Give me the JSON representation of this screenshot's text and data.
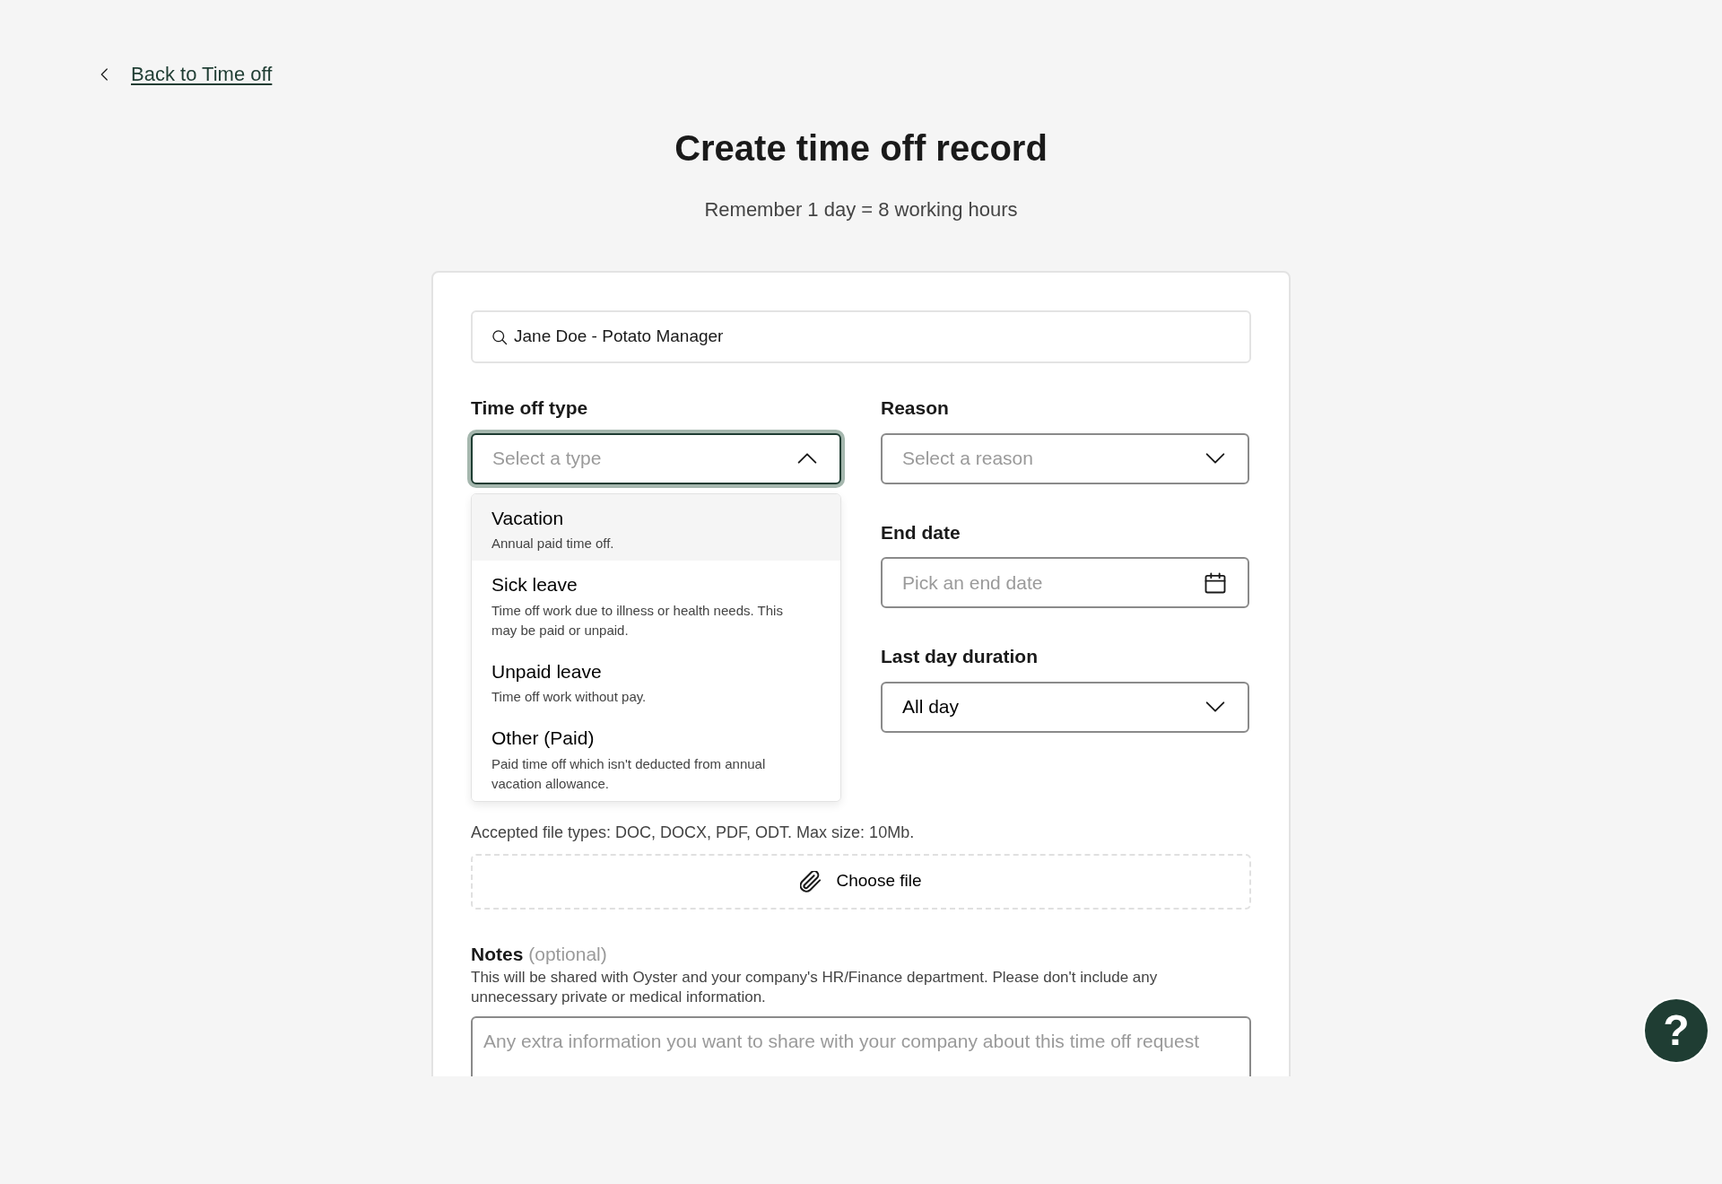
{
  "back_link": {
    "label": "Back to Time off"
  },
  "title": "Create time off record",
  "subtitle": "Remember 1 day = 8 working hours",
  "employee_search": {
    "value": "Jane Doe - Potato Manager"
  },
  "time_off_type": {
    "label": "Time off type",
    "placeholder": "Select a type",
    "expanded": true,
    "options": [
      {
        "label": "Vacation",
        "description": "Annual paid time off.",
        "highlighted": true
      },
      {
        "label": "Sick leave",
        "description": "Time off work due to illness or health needs. This may be paid or unpaid.",
        "highlighted": false
      },
      {
        "label": "Unpaid leave",
        "description": "Time off work without pay.",
        "highlighted": false
      },
      {
        "label": "Other (Paid)",
        "description": "Paid time off which isn't deducted from annual vacation allowance.",
        "highlighted": false
      }
    ]
  },
  "reason": {
    "label": "Reason",
    "placeholder": "Select a reason",
    "expanded": false
  },
  "end_date": {
    "label": "End date",
    "placeholder": "Pick an end date"
  },
  "last_day_duration": {
    "label": "Last day duration",
    "value": "All day",
    "expanded": false
  },
  "attachment": {
    "hint": "Accepted file types: DOC, DOCX, PDF, ODT. Max size: 10Mb.",
    "button": "Choose file"
  },
  "notes": {
    "label": "Notes",
    "optional": "(optional)",
    "hint": "This will be shared with Oyster and your company's HR/Finance department. Please don't include any unnecessary private or medical information.",
    "placeholder": "Any extra information you want to share with your company about this time off request"
  },
  "help_button": {
    "label": "?"
  }
}
